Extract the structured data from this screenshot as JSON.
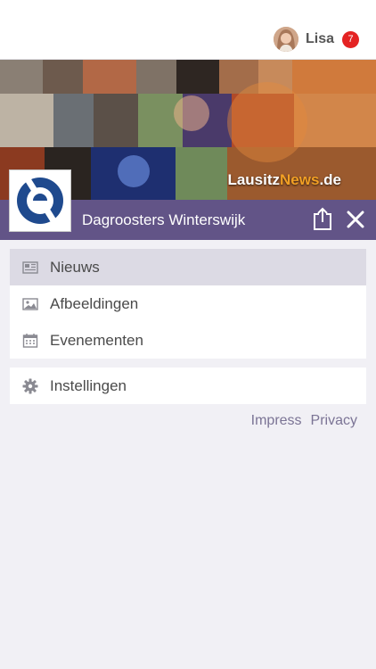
{
  "user": {
    "name": "Lisa",
    "notification_count": "7"
  },
  "hero": {
    "brand_name": "Lausitz",
    "brand_accent": "News",
    "brand_suffix": ".de"
  },
  "header": {
    "title": "Dagroosters Winterswijk"
  },
  "menu": {
    "items": [
      {
        "label": "Nieuws",
        "icon": "newspaper-icon",
        "active": true
      },
      {
        "label": "Afbeeldingen",
        "icon": "image-icon",
        "active": false
      },
      {
        "label": "Evenementen",
        "icon": "calendar-icon",
        "active": false
      }
    ],
    "settings": {
      "label": "Instellingen",
      "icon": "gear-icon"
    }
  },
  "footer": {
    "impress": "Impress",
    "privacy": "Privacy"
  },
  "colors": {
    "header_purple": "#625487",
    "active_item": "#dcdae4",
    "badge_red": "#e42323",
    "brand_orange": "#f2a024"
  }
}
